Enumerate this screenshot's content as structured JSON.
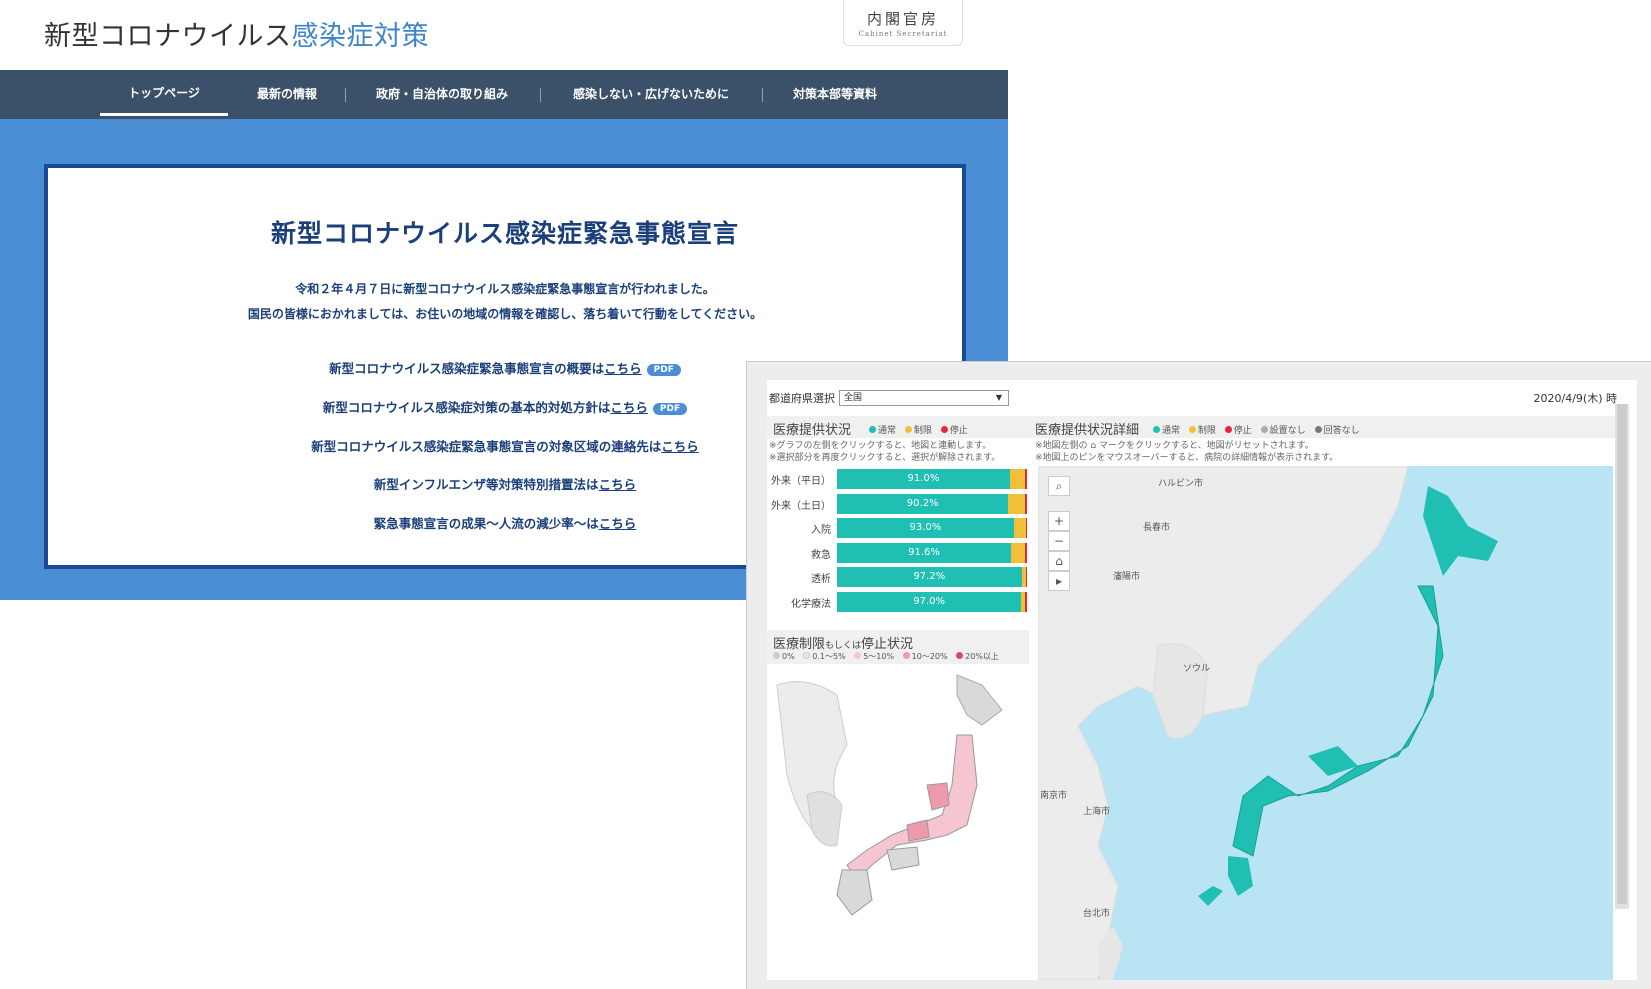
{
  "site": {
    "title_main": "新型コロナウイルス",
    "title_accent": "感染症対策",
    "logo_kanji": "内閣官房",
    "logo_en": "Cabinet Secretariat",
    "nav": [
      {
        "label": "トップページ"
      },
      {
        "label": "最新の情報"
      },
      {
        "label": "政府・自治体の取り組み"
      },
      {
        "label": "感染しない・広げないために"
      },
      {
        "label": "対策本部等資料"
      }
    ],
    "notice": {
      "title": "新型コロナウイルス感染症緊急事態宣言",
      "body1": "令和２年４月７日に新型コロナウイルス感染症緊急事態宣言が行われました。",
      "body2": "国民の皆様におかれましては、お住いの地域の情報を確認し、落ち着いて行動をしてください。",
      "links": [
        {
          "text": "新型コロナウイルス感染症緊急事態宣言の概要は",
          "link": "こちら",
          "badge": "PDF"
        },
        {
          "text": "新型コロナウイルス感染症対策の基本的対処方針は",
          "link": "こちら",
          "badge": "PDF"
        },
        {
          "text": "新型コロナウイルス感染症緊急事態宣言の対象区域の連絡先は",
          "link": "こちら",
          "badge": ""
        },
        {
          "text": "新型インフルエンザ等対策特別措置法は",
          "link": "こちら",
          "badge": ""
        },
        {
          "text": "緊急事態宣言の成果～人流の減少率～は",
          "link": "こちら",
          "badge": ""
        }
      ]
    }
  },
  "dashboard": {
    "pref_label": "都道府県選択",
    "pref_value": "全国",
    "date": "2020/4/9(木) 時",
    "status_panel": {
      "title": "医療提供状況",
      "legend": [
        {
          "label": "通常",
          "color": "#1fbfb3"
        },
        {
          "label": "制限",
          "color": "#f2c038"
        },
        {
          "label": "停止",
          "color": "#e8243a"
        }
      ],
      "note1": "※グラフの左側をクリックすると、地図と連動します。",
      "note2": "※選択部分を再度クリックすると、選択が解除されます。"
    },
    "detail_panel": {
      "title": "医療提供状況詳細",
      "legend": [
        {
          "label": "通常",
          "color": "#1fbfb3"
        },
        {
          "label": "制限",
          "color": "#f2c038"
        },
        {
          "label": "停止",
          "color": "#e8243a"
        },
        {
          "label": "設置なし",
          "color": "#aaaaaa"
        },
        {
          "label": "回答なし",
          "color": "#777777"
        }
      ],
      "note1": "※地図左側の ⌂ マークをクリックすると、地図がリセットされます。",
      "note2": "※地図上のピンをマウスオーバーすると、病院の詳細情報が表示されます。"
    },
    "restriction_panel": {
      "title_a": "医療制限",
      "title_b": "もしくは",
      "title_c": "停止状況",
      "legend": [
        {
          "label": "0%",
          "color": "#cccccc"
        },
        {
          "label": "0.1～5%",
          "color": "#e6e6e6"
        },
        {
          "label": "5～10%",
          "color": "#f5c6cf"
        },
        {
          "label": "10～20%",
          "color": "#ee9aac"
        },
        {
          "label": "20%以上",
          "color": "#d9476a"
        }
      ]
    },
    "cities": [
      "ハルビン市",
      "長春市",
      "瀋陽市",
      "ソウル",
      "南京市",
      "上海市",
      "台北市"
    ]
  },
  "chart_data": {
    "type": "bar",
    "title": "医療提供状況",
    "categories": [
      "外来（平日）",
      "外来（土日）",
      "入院",
      "救急",
      "透析",
      "化学療法"
    ],
    "series": [
      {
        "name": "通常",
        "values": [
          91.0,
          90.2,
          93.0,
          91.6,
          97.2,
          97.0
        ]
      },
      {
        "name": "制限",
        "values": [
          8.0,
          8.8,
          6.5,
          7.4,
          2.6,
          2.2
        ]
      },
      {
        "name": "停止",
        "values": [
          1.0,
          1.0,
          0.5,
          1.0,
          0.2,
          0.8
        ]
      }
    ],
    "value_labels": [
      "91.0%",
      "90.2%",
      "93.0%",
      "91.6%",
      "97.2%",
      "97.0%"
    ],
    "xlim": [
      0,
      100
    ]
  }
}
